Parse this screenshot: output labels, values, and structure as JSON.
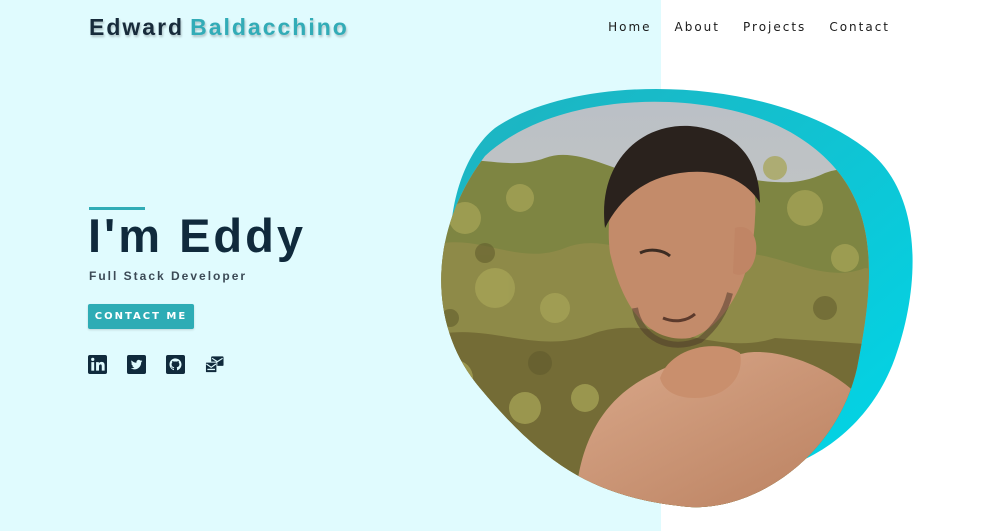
{
  "brand": {
    "first": "Edward",
    "last": "Baldacchino"
  },
  "nav": [
    {
      "label": "Home"
    },
    {
      "label": "About"
    },
    {
      "label": "Projects"
    },
    {
      "label": "Contact"
    }
  ],
  "hero": {
    "title": "I'm Eddy",
    "subtitle": "Full Stack Developer",
    "cta_label": "CONTACT ME"
  },
  "socials": [
    {
      "icon": "linkedin-icon"
    },
    {
      "icon": "twitter-icon"
    },
    {
      "icon": "github-icon"
    },
    {
      "icon": "mail-bulk-icon"
    }
  ],
  "colors": {
    "accent": "#31acb6",
    "dark": "#102a3c",
    "background_left": "#e0fbfe",
    "background_right": "#ffffff",
    "blob_gradient_start": "#1fb2bf",
    "blob_gradient_end": "#00d6e8"
  }
}
